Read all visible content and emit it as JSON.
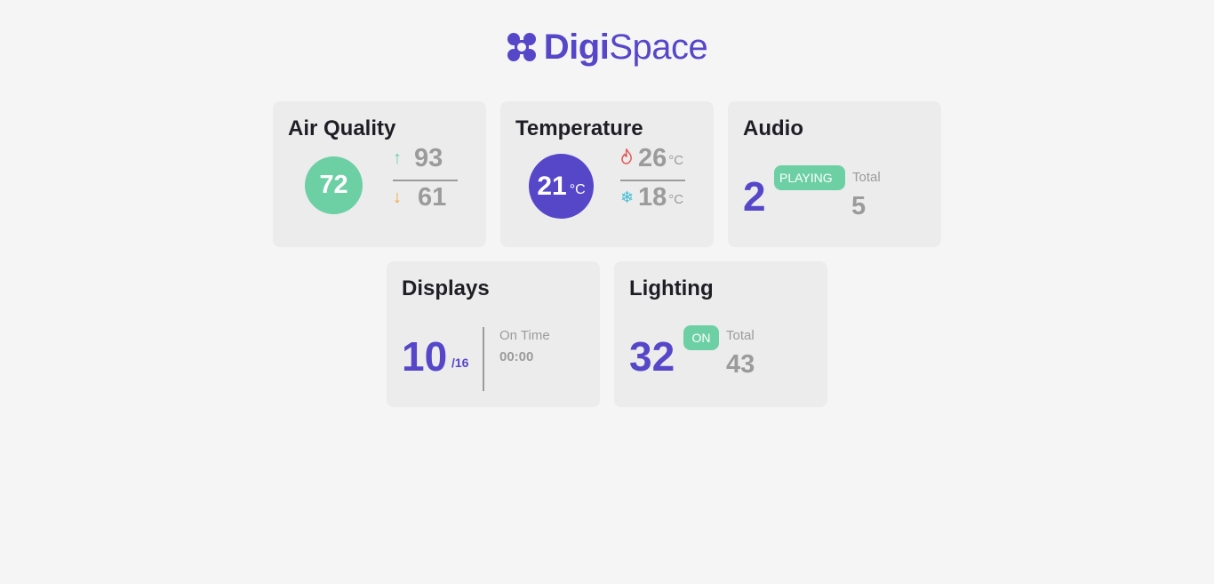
{
  "brand": {
    "name_bold": "Digi",
    "name_light": "Space",
    "color": "#5647c9"
  },
  "cards": {
    "air_quality": {
      "title": "Air Quality",
      "current": "72",
      "high": "93",
      "low": "61",
      "high_icon": "arrow-up-icon",
      "low_icon": "arrow-down-icon"
    },
    "temperature": {
      "title": "Temperature",
      "current": "21",
      "unit": "°C",
      "high": "26",
      "low": "18",
      "high_icon": "flame-icon",
      "low_icon": "snowflake-icon"
    },
    "audio": {
      "title": "Audio",
      "playing_count": "2",
      "status": "PLAYING",
      "total_label": "Total",
      "total": "5"
    },
    "displays": {
      "title": "Displays",
      "on_count": "10",
      "of_total": "/16",
      "on_time_label": "On Time",
      "on_time": "00:00"
    },
    "lighting": {
      "title": "Lighting",
      "on_count": "32",
      "status": "ON",
      "total_label": "Total",
      "total": "43"
    }
  },
  "colors": {
    "accent": "#5647c9",
    "green": "#6dd0a4",
    "orange": "#f3a93c",
    "red": "#e05a5a",
    "cyan": "#3fbcd4",
    "muted": "#9b9b9b",
    "card_bg": "#ececec",
    "page_bg": "#f5f5f5"
  }
}
